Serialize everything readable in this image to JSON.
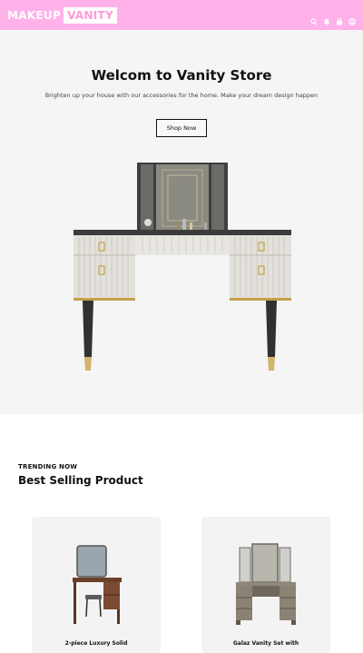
{
  "header": {
    "logo_part1": "MAKEUP",
    "logo_part2": "VANITY",
    "icons": [
      "search-icon",
      "bell-icon",
      "bag-icon",
      "user-icon"
    ]
  },
  "hero": {
    "title": "Welcom to Vanity Store",
    "subtitle": "Brighten up your house with our accessories for the home. Make your dream design happen",
    "cta": "Shop Now"
  },
  "section": {
    "eyebrow": "TRENDING NOW",
    "heading": "Best Selling Product"
  },
  "products": [
    {
      "title": "2-piece Luxury Solid"
    },
    {
      "title": "Galaz Vanity Set with"
    }
  ],
  "colors": {
    "brand_pink": "#ffb1ea",
    "hero_bg": "#f5f5f5"
  }
}
